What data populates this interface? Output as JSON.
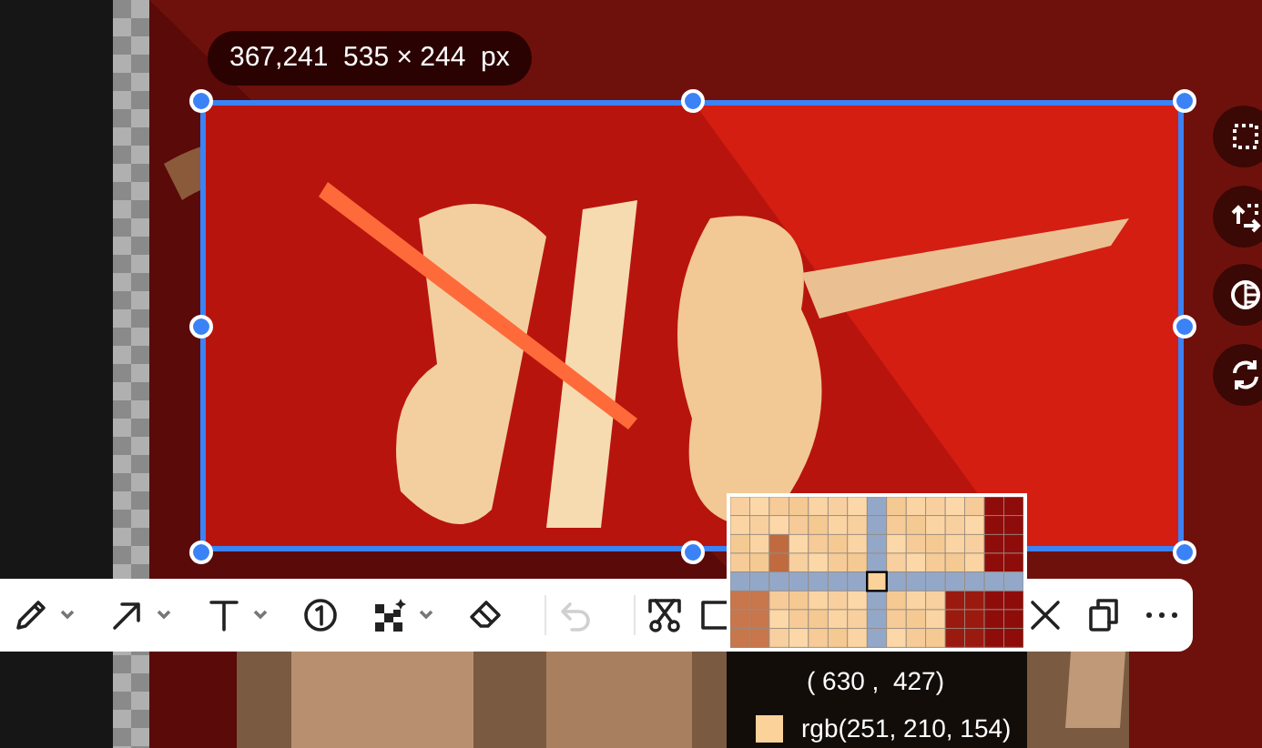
{
  "size_label": "367,241  535 × 244  px",
  "side_tools": [
    {
      "kind": "crop"
    },
    {
      "kind": "resize"
    },
    {
      "kind": "contrast"
    },
    {
      "kind": "refresh"
    }
  ],
  "toolbar": [
    {
      "kind": "pencil",
      "dropdown": true,
      "disabled": false
    },
    {
      "kind": "arrow",
      "dropdown": true,
      "disabled": false
    },
    {
      "kind": "text",
      "dropdown": true,
      "disabled": false
    },
    {
      "kind": "number",
      "dropdown": false,
      "disabled": false
    },
    {
      "kind": "mosaic",
      "dropdown": true,
      "disabled": false
    },
    {
      "kind": "eraser",
      "dropdown": false,
      "disabled": false
    },
    {
      "kind": "divider"
    },
    {
      "kind": "undo",
      "dropdown": false,
      "disabled": true
    },
    {
      "kind": "divider"
    },
    {
      "kind": "cut",
      "dropdown": false,
      "disabled": false
    },
    {
      "kind": "rect",
      "dropdown": false,
      "disabled": false
    }
  ],
  "toolbar_end": [
    {
      "kind": "close"
    },
    {
      "kind": "copy"
    },
    {
      "kind": "more"
    }
  ],
  "magnifier": {
    "position": "( 630 ,  427)",
    "color_text": "rgb(251, 210, 154)",
    "color": "#fbd29a"
  }
}
